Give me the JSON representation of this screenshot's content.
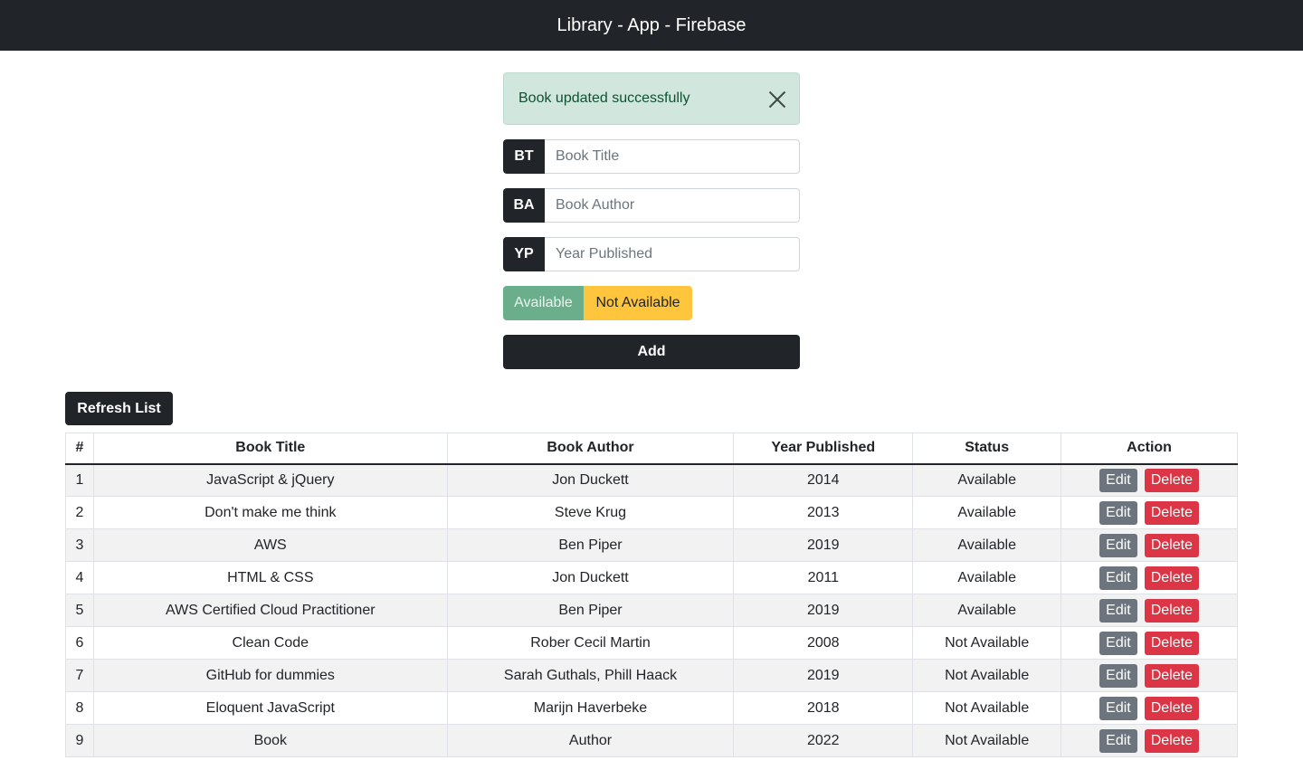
{
  "navbar": {
    "brand": "Library - App - Firebase"
  },
  "alert": {
    "message": "Book updated successfully",
    "icon": "close-icon"
  },
  "form": {
    "title": {
      "prefix": "BT",
      "placeholder": "Book Title",
      "value": ""
    },
    "author": {
      "prefix": "BA",
      "placeholder": "Book Author",
      "value": ""
    },
    "year": {
      "prefix": "YP",
      "placeholder": "Year Published",
      "value": ""
    },
    "status_options": {
      "available": "Available",
      "not_available": "Not Available"
    },
    "add_label": "Add"
  },
  "refresh_label": "Refresh List",
  "table": {
    "headers": [
      "#",
      "Book Title",
      "Book Author",
      "Year Published",
      "Status",
      "Action"
    ],
    "edit_label": "Edit",
    "delete_label": "Delete",
    "rows": [
      {
        "num": "1",
        "title": "JavaScript & jQuery",
        "author": "Jon Duckett",
        "year": "2014",
        "status": "Available"
      },
      {
        "num": "2",
        "title": "Don't make me think",
        "author": "Steve Krug",
        "year": "2013",
        "status": "Available"
      },
      {
        "num": "3",
        "title": "AWS",
        "author": "Ben Piper",
        "year": "2019",
        "status": "Available"
      },
      {
        "num": "4",
        "title": "HTML & CSS",
        "author": "Jon Duckett",
        "year": "2011",
        "status": "Available"
      },
      {
        "num": "5",
        "title": "AWS Certified Cloud Practitioner",
        "author": "Ben Piper",
        "year": "2019",
        "status": "Available"
      },
      {
        "num": "6",
        "title": "Clean Code",
        "author": "Rober Cecil Martin",
        "year": "2008",
        "status": "Not Available"
      },
      {
        "num": "7",
        "title": "GitHub for dummies",
        "author": "Sarah Guthals, Phill Haack",
        "year": "2019",
        "status": "Not Available"
      },
      {
        "num": "8",
        "title": "Eloquent JavaScript",
        "author": "Marijn Haverbeke",
        "year": "2018",
        "status": "Not Available"
      },
      {
        "num": "9",
        "title": "Book",
        "author": "Author",
        "year": "2022",
        "status": "Not Available"
      }
    ]
  },
  "colors": {
    "navbar_bg": "#212529",
    "alert_bg": "#d1e7dd",
    "alert_text": "#0f5132",
    "available_btn": "#6aae8c",
    "not_available_btn": "#ffc53d",
    "edit_btn": "#6c757d",
    "delete_btn": "#dc3545"
  }
}
